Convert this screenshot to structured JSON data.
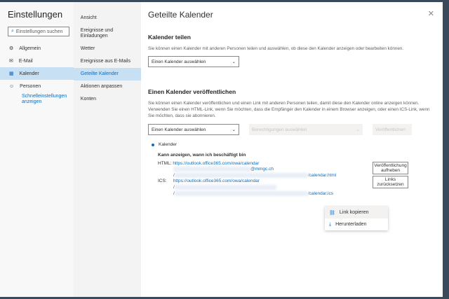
{
  "sidebar": {
    "title": "Einstellungen",
    "search_placeholder": "Einstellungen suchen",
    "items": [
      {
        "label": "Allgemein"
      },
      {
        "label": "E-Mail"
      },
      {
        "label": "Kalender"
      },
      {
        "label": "Personen"
      }
    ],
    "quick_settings": "Schnelleinstellungen anzeigen"
  },
  "subnav": {
    "items": [
      {
        "label": "Ansicht"
      },
      {
        "label": "Ereignisse und Einladungen"
      },
      {
        "label": "Wetter"
      },
      {
        "label": "Ereignisse aus E-Mails"
      },
      {
        "label": "Geteilte Kalender"
      },
      {
        "label": "Aktionen anpassen"
      },
      {
        "label": "Konten"
      }
    ]
  },
  "main": {
    "title": "Geteilte Kalender",
    "share": {
      "heading": "Kalender teilen",
      "desc": "Sie können einen Kalender mit anderen Personen teilen und auswählen, ob diese den Kalender anzeigen oder bearbeiten können.",
      "select": "Einen Kalender auswählen"
    },
    "publish": {
      "heading": "Einen Kalender veröffentlichen",
      "desc": "Sie können einen Kalender veröffentlichen und einen Link mit anderen Personen teilen, damit diese den Kalender online anzeigen können. Verwenden Sie einen HTML-Link, wenn Sie möchten, dass die Empfänger den Kalender in einem Browser anzeigen, oder einen ICS-Link, wenn Sie möchten, dass sie abonnieren.",
      "select": "Einen Kalender auswählen",
      "permissions": "Berechtigungen auswählen",
      "publish_btn": "Veröffentlichen"
    },
    "published": {
      "calendar": "Kalender",
      "permission": "Kann anzeigen, wann ich beschäftigt bin",
      "html_label": "HTML:",
      "html_url": "https://outlook.office365.com/owa/calendar",
      "html_domain": "@mmgc.ch",
      "html_end": "/calendar.html",
      "ics_label": "ICS:",
      "ics_url": "https://outlook.office365.com/owa/calendar",
      "ics_end": "/calendar.ics",
      "slash": "/",
      "unpublish": "Veröffentlichung aufheben",
      "reset": "Links zurücksetzen"
    },
    "context_menu": {
      "copy": "Link kopieren",
      "download": "Herunterladen"
    }
  }
}
